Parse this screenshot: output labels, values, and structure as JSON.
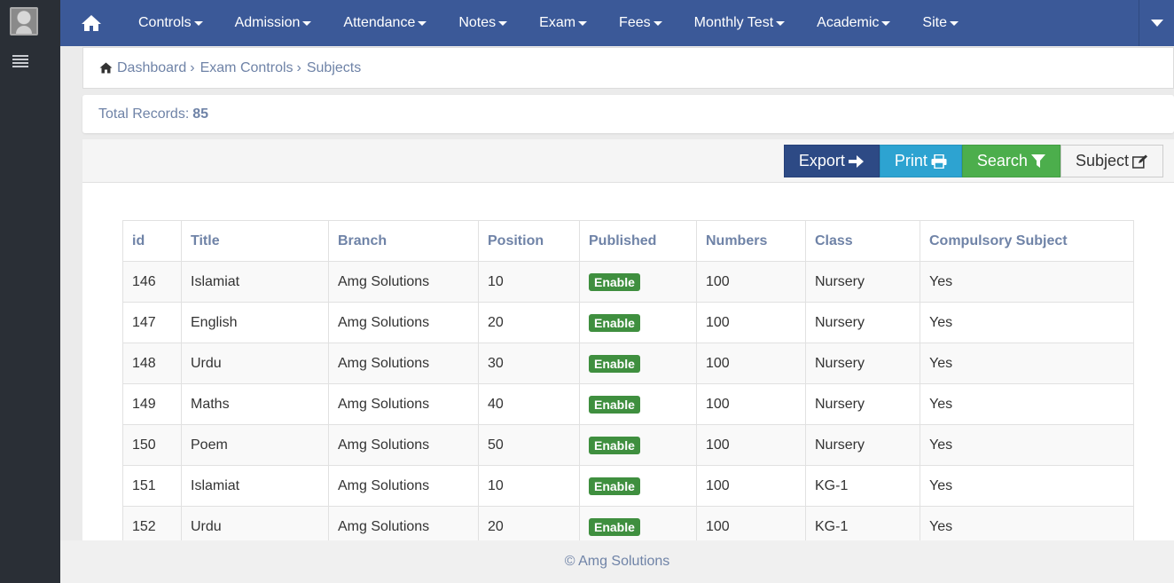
{
  "nav": {
    "items": [
      {
        "label": "Controls"
      },
      {
        "label": "Admission"
      },
      {
        "label": "Attendance"
      },
      {
        "label": "Notes"
      },
      {
        "label": "Exam"
      },
      {
        "label": "Fees"
      },
      {
        "label": "Monthly Test"
      },
      {
        "label": "Academic"
      },
      {
        "label": "Site"
      }
    ]
  },
  "breadcrumb": {
    "items": [
      "Dashboard",
      "Exam Controls",
      "Subjects"
    ]
  },
  "totals": {
    "label": "Total Records:",
    "value": "85"
  },
  "toolbar": {
    "export_label": "Export",
    "print_label": "Print",
    "search_label": "Search",
    "subject_label": "Subject"
  },
  "table": {
    "columns": [
      "id",
      "Title",
      "Branch",
      "Position",
      "Published",
      "Numbers",
      "Class",
      "Compulsory Subject"
    ],
    "rows": [
      [
        "146",
        "Islamiat",
        "Amg Solutions",
        "10",
        "Enable",
        "100",
        "Nursery",
        "Yes"
      ],
      [
        "147",
        "English",
        "Amg Solutions",
        "20",
        "Enable",
        "100",
        "Nursery",
        "Yes"
      ],
      [
        "148",
        "Urdu",
        "Amg Solutions",
        "30",
        "Enable",
        "100",
        "Nursery",
        "Yes"
      ],
      [
        "149",
        "Maths",
        "Amg Solutions",
        "40",
        "Enable",
        "100",
        "Nursery",
        "Yes"
      ],
      [
        "150",
        "Poem",
        "Amg Solutions",
        "50",
        "Enable",
        "100",
        "Nursery",
        "Yes"
      ],
      [
        "151",
        "Islamiat",
        "Amg Solutions",
        "10",
        "Enable",
        "100",
        "KG-1",
        "Yes"
      ],
      [
        "152",
        "Urdu",
        "Amg Solutions",
        "20",
        "Enable",
        "100",
        "KG-1",
        "Yes"
      ]
    ]
  },
  "footer": {
    "text": "© Amg Solutions"
  },
  "colors": {
    "nav": "#3b5998",
    "sidebar": "#2a2f36",
    "export": "#2d4a85",
    "print": "#2da3d1",
    "search": "#4cae4c",
    "badge": "#3f8f3f"
  }
}
